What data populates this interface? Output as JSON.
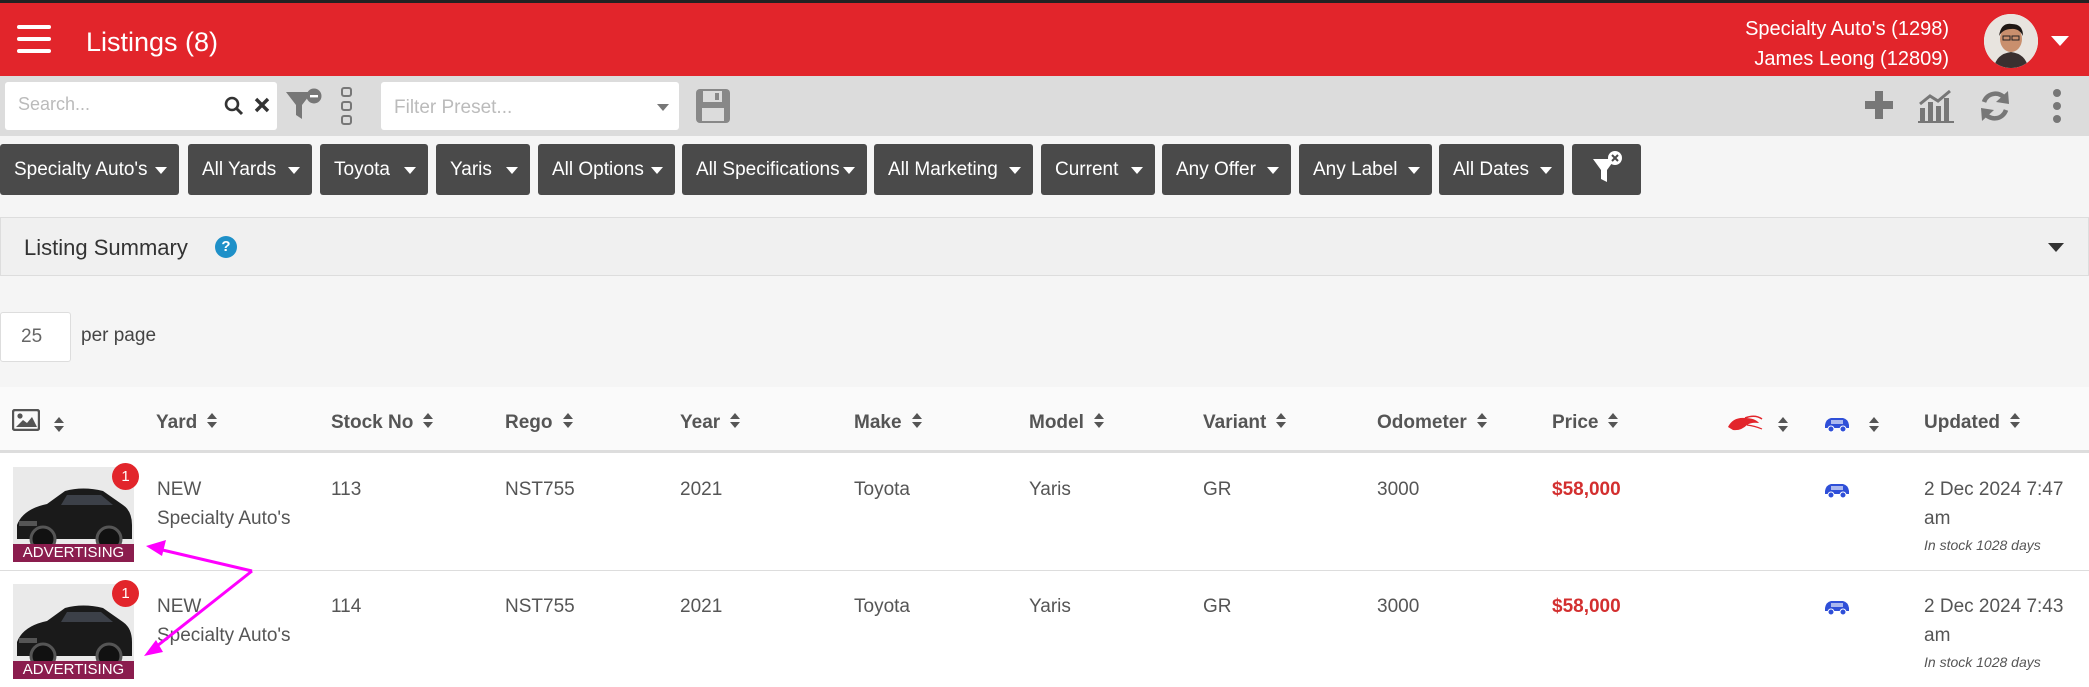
{
  "header": {
    "title": "Listings (8)",
    "account_line1": "Specialty Auto's (1298)",
    "account_line2": "James Leong (12809)"
  },
  "toolbar": {
    "search_placeholder": "Search...",
    "preset_placeholder": "Filter Preset..."
  },
  "filters": [
    "Specialty Auto's",
    "All Yards",
    "Toyota",
    "Yaris",
    "All Options",
    "All Specifications",
    "All Marketing",
    "Current",
    "Any Offer",
    "Any Label",
    "All Dates"
  ],
  "summary": {
    "label": "Listing Summary",
    "help": "?"
  },
  "pagination": {
    "per_page_value": "25",
    "per_page_label": "per page"
  },
  "table": {
    "headers": {
      "yard": "Yard",
      "stock": "Stock No",
      "rego": "Rego",
      "year": "Year",
      "make": "Make",
      "model": "Model",
      "variant": "Variant",
      "odometer": "Odometer",
      "price": "Price",
      "updated": "Updated"
    },
    "rows": [
      {
        "badge": "1",
        "label": "ADVERTISING",
        "yard_status": "NEW",
        "yard_name": "Specialty Auto's",
        "stock": "113",
        "rego": "NST755",
        "year": "2021",
        "make": "Toyota",
        "model": "Yaris",
        "variant": "GR",
        "odometer": "3000",
        "price": "$58,000",
        "updated_line1": "2 Dec 2024 7:47",
        "updated_line2": "am",
        "in_stock": "In stock 1028 days"
      },
      {
        "badge": "1",
        "label": "ADVERTISING",
        "yard_status": "NEW",
        "yard_name": "Specialty Auto's",
        "stock": "114",
        "rego": "NST755",
        "year": "2021",
        "make": "Toyota",
        "model": "Yaris",
        "variant": "GR",
        "odometer": "3000",
        "price": "$58,000",
        "updated_line1": "2 Dec 2024 7:43",
        "updated_line2": "am",
        "in_stock": "In stock 1028 days"
      }
    ]
  },
  "icons": {
    "header": [
      "hamburger-menu-icon",
      "avatar",
      "chevron-down-icon"
    ],
    "toolbar": [
      "search-icon",
      "close-icon",
      "filter-minus-icon",
      "column-options-icon",
      "save-icon",
      "plus-icon",
      "chart-icon",
      "refresh-icon",
      "more-vertical-icon"
    ],
    "columns": [
      "image-icon",
      "shrimp-icon",
      "car-icon"
    ]
  },
  "colors": {
    "header_bg": "#e2252b",
    "chip_bg": "#4a4a4a",
    "price": "#d32f2f",
    "advertising": "#8b1d4e",
    "badge": "#e2252b",
    "car_icon": "#2f4fd8",
    "annotation_arrow": "#ff00ff"
  }
}
